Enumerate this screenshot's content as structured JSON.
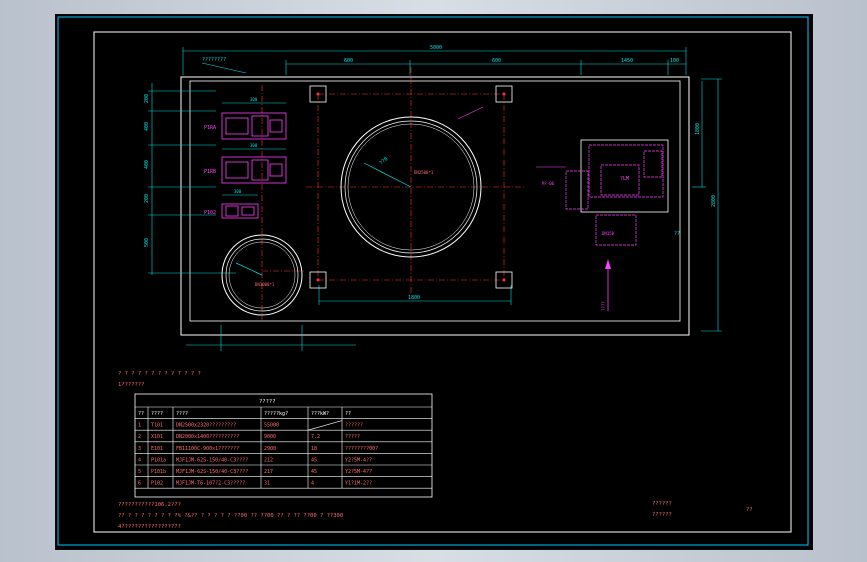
{
  "colors": {
    "background": "#000000",
    "frame": "#00c8ff",
    "outline": "#ffffff",
    "dimension": "#00e0e0",
    "equipment": "#ff40ff",
    "centerline": "#ff3030",
    "table_text": "#ffffff"
  },
  "dims": {
    "overall": "5000",
    "seg1": "600",
    "seg2": "600",
    "seg3": "1450",
    "seg4": "100",
    "base_bottom": "1800",
    "pump_width": "300"
  },
  "labels": {
    "tank_big_note": "??0",
    "tank_big_center": "DN2500*1",
    "tank_small_center": "DN1000*1",
    "fan_label": "?LM",
    "fan_model": "M?-06",
    "pump1": "P1RA",
    "pump2": "P1RB",
    "pump3": "P102",
    "motor_note": "DN150",
    "arrow_note": "????",
    "corner_note": "??",
    "top_note": "????????"
  },
  "notes": {
    "line1": "? ? ? ? ? ? ? ? ? ? ? ? ?",
    "line2": "1???????",
    "foot1": "???????????106.2???",
    "foot2": "?? ? ? ? ? ? ? ? ?% ?&?? ? ? ? ? ? ??00 ?? ??00 ?? ? ?? ??00 ? ??300",
    "foot3": "4??????????????????"
  },
  "title_block": {
    "line1": "??????",
    "line2": "??????",
    "mark": "??"
  },
  "table": {
    "title": "?????",
    "headers": [
      "??",
      "????",
      "????",
      "?????kg?",
      "???kW?",
      "??"
    ],
    "rows": [
      [
        "1",
        "T101",
        "DN2500x2320?????????",
        "55000",
        "",
        "??????"
      ],
      [
        "2",
        "X101",
        "DN2000x1400??????????",
        "9000",
        "7.2",
        "?????"
      ],
      [
        "3",
        "E101",
        "FB11100C-900x1???????",
        "2900",
        "18",
        "????????00?"
      ],
      [
        "4",
        "P101a",
        "MJF1JM-62S-150/40-C3????",
        "212",
        "45",
        "Y2?5M-4??"
      ],
      [
        "5",
        "P101b",
        "MJF1JM-62S-150/40-C3????",
        "217",
        "45",
        "Y2?5M-4??"
      ],
      [
        "6",
        "P102",
        "MJF1JM-T6-107?2-C3?????",
        "31",
        "4",
        "Y1?1M-2??"
      ]
    ]
  }
}
